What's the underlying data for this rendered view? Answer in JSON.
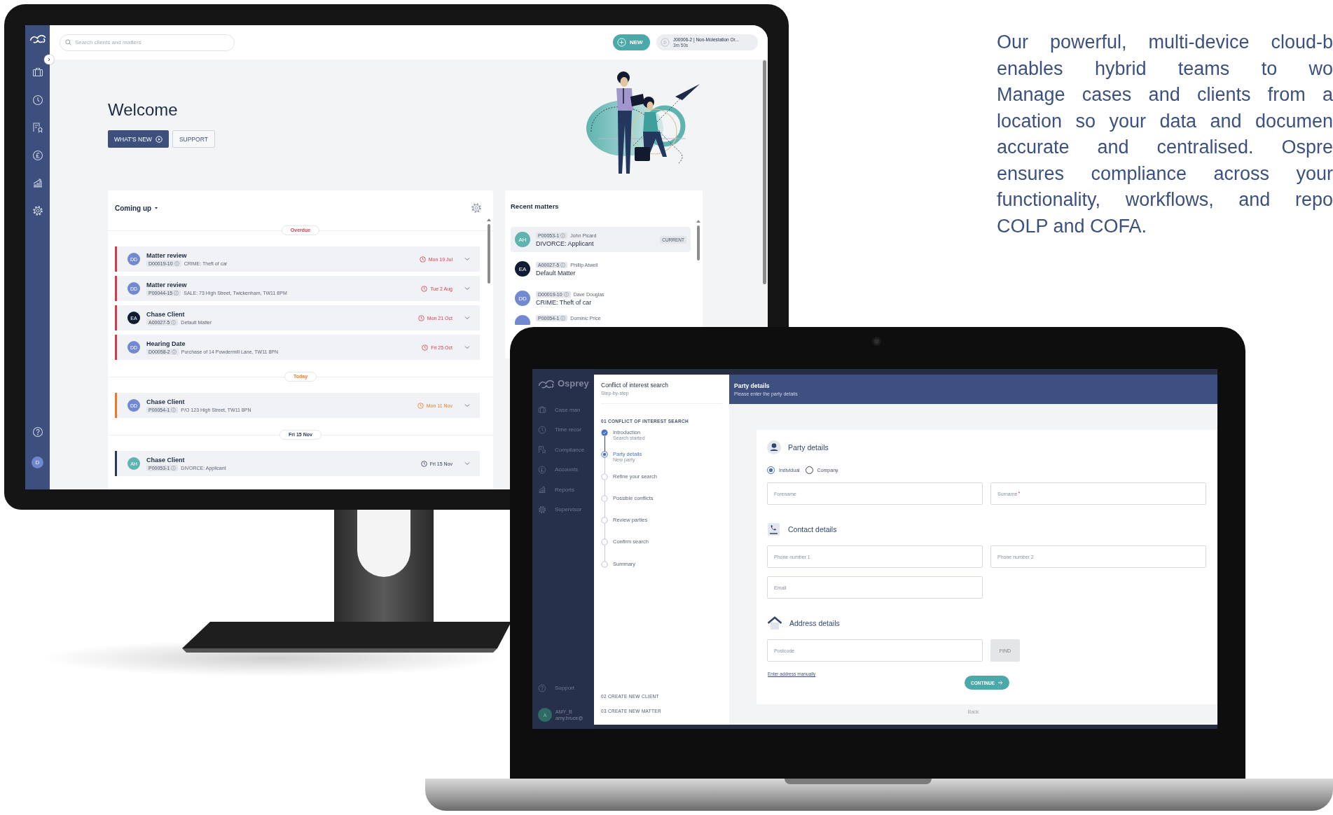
{
  "monitor": {
    "search": {
      "placeholder": "Search clients and matters"
    },
    "new_button": "NEW",
    "timer": {
      "title": "J00006-2 | Non-Molestation Or...",
      "elapsed": "3m 50s"
    },
    "user_initial": "D",
    "welcome": {
      "title": "Welcome",
      "buttons": [
        {
          "label": "WHAT'S NEW",
          "kind": "primary"
        },
        {
          "label": "SUPPORT",
          "kind": "secondary"
        }
      ]
    },
    "coming_up": {
      "title": "Coming up",
      "groups": [
        {
          "label": "Overdue",
          "color": "#d43c4c",
          "rows": [
            {
              "initials": "DD",
              "color": "#7189d1",
              "title": "Matter review",
              "code": "D00019-10",
              "description": "CRIME: Theft of car",
              "date": "Mon 19 Jul"
            },
            {
              "initials": "DD",
              "color": "#7189d1",
              "title": "Matter review",
              "code": "P00044-15",
              "description": "SALE: 73 High Street, Twickenham, TW11 8PM",
              "date": "Tue 2 Aug"
            },
            {
              "initials": "EA",
              "color": "#101c33",
              "title": "Chase Client",
              "code": "A00027-5",
              "description": "Default Matter",
              "date": "Mon 21 Oct"
            },
            {
              "initials": "DD",
              "color": "#7189d1",
              "title": "Hearing Date",
              "code": "D00058-2",
              "description": "Purchase of 14 Powdermill Lane, TW11 8PN",
              "date": "Fri 25 Oct"
            }
          ]
        },
        {
          "label": "Today",
          "color": "#e97b2c",
          "rows": [
            {
              "initials": "DD",
              "color": "#7189d1",
              "title": "Chase Client",
              "code": "P00054-1",
              "description": "P/O 123 High Street, TW11 8PN",
              "date": "Mon 11 Nov"
            }
          ]
        },
        {
          "label": "Fri 15 Nov",
          "color": "#2c3858",
          "rows": [
            {
              "initials": "AH",
              "color": "#5fb4b0",
              "title": "Chase Client",
              "code": "P00053-1",
              "description": "DIVORCE: Applicant",
              "date": "Fri 15 Nov"
            }
          ]
        }
      ]
    },
    "recent_matters": {
      "title": "Recent matters",
      "items": [
        {
          "initials": "AH",
          "color": "#5fb4b0",
          "code": "P00053-1",
          "person": "John Picard",
          "title": "DIVORCE: Applicant",
          "badge": "CURRENT",
          "selected": true
        },
        {
          "initials": "EA",
          "color": "#101c33",
          "code": "A00027-5",
          "person": "Phillip Atwell",
          "title": "Default Matter",
          "selected": false
        },
        {
          "initials": "DD",
          "color": "#7189d1",
          "code": "D00019-10",
          "person": "Dave Douglas",
          "title": "CRIME: Theft of car",
          "selected": false
        },
        {
          "color": "#7189d1",
          "code": "P00054-1",
          "person": "Dominic Price",
          "selected": false
        }
      ]
    }
  },
  "laptop": {
    "app": {
      "brand": "Osprey",
      "nav": [
        "Case man",
        "Time recor",
        "Compliance",
        "Accounts",
        "Reports",
        "Supervisor"
      ],
      "support": "Support",
      "user": {
        "initial": "A",
        "name": "AMY_B",
        "email": "amy.bruce@"
      }
    },
    "wizard": {
      "title": "Conflict of interest search",
      "subtitle": "Step-by-step",
      "section": "01 CONFLICT OF INTEREST SEARCH",
      "steps": [
        {
          "label": "Introduction",
          "note": "Search started",
          "completed": true,
          "selected": false
        },
        {
          "label": "Party details",
          "note": "New party",
          "completed": false,
          "selected": true
        },
        {
          "label": "Refine your search",
          "completed": false,
          "selected": false
        },
        {
          "label": "Possible conflicts",
          "completed": false,
          "selected": false
        },
        {
          "label": "Review parties",
          "completed": false,
          "selected": false
        },
        {
          "label": "Confirm search",
          "completed": false,
          "selected": false
        },
        {
          "label": "Summary",
          "completed": false,
          "selected": false
        }
      ],
      "later_sections": [
        "02 CREATE NEW CLIENT",
        "03 CREATE NEW MATTER"
      ]
    },
    "form": {
      "title": "Party details",
      "subtitle": "Please enter the party details",
      "sections": [
        {
          "kind": "person",
          "title": "Party details",
          "options": [
            {
              "label": "Individual",
              "selected": true
            },
            {
              "label": "Company",
              "selected": false
            }
          ],
          "rows": [
            [
              {
                "kind": "input",
                "placeholder": "Forename"
              },
              {
                "kind": "input",
                "placeholder": "Surname",
                "required_mark": "*"
              }
            ]
          ]
        },
        {
          "kind": "phone",
          "title": "Contact details",
          "rows": [
            [
              {
                "kind": "input",
                "placeholder": "Phone number 1"
              },
              {
                "kind": "input",
                "placeholder": "Phone number 2"
              }
            ],
            [
              {
                "kind": "input",
                "placeholder": "Email"
              }
            ]
          ]
        },
        {
          "kind": "house",
          "title": "Address details",
          "rows": [
            [
              {
                "kind": "input",
                "placeholder": "Postcode"
              },
              {
                "kind": "button",
                "label": "FIND",
                "disabled": true
              }
            ]
          ],
          "link": "Enter address manually"
        }
      ],
      "continue_button": "CONTINUE",
      "back_link": "Back"
    }
  },
  "promo": {
    "lines": [
      "Our powerful, multi-device cloud-b",
      "enables hybrid teams to wo",
      "Manage cases and clients from a",
      "location so your data and documen",
      "accurate and centralised. Ospre",
      "ensures compliance across your",
      "functionality, workflows, and repo",
      "COLP and COFA."
    ]
  }
}
